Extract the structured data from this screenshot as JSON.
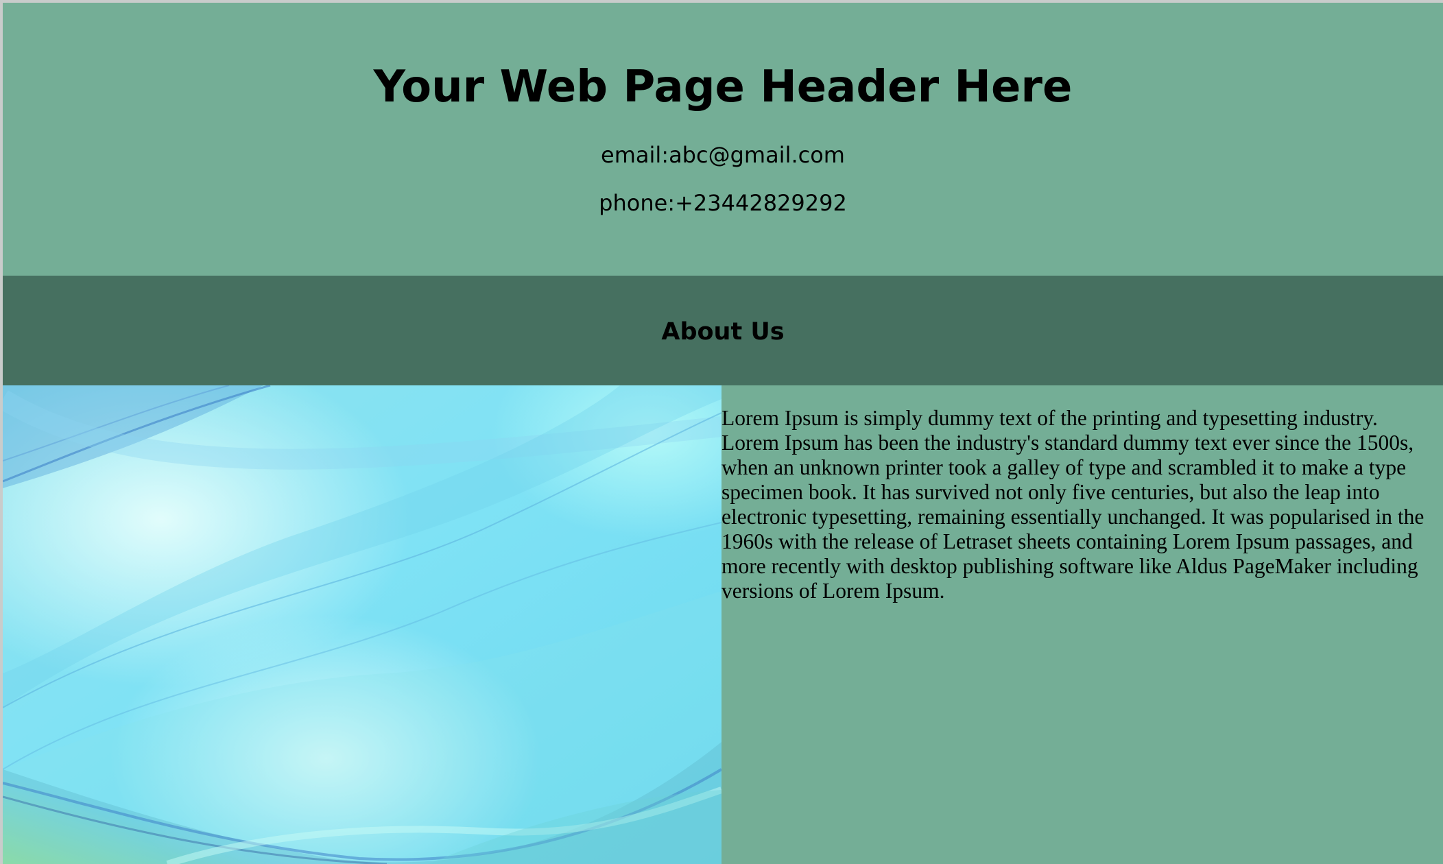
{
  "header": {
    "title": "Your Web Page Header Here",
    "email": "email:abc@gmail.com",
    "phone": "phone:+23442829292"
  },
  "about": {
    "heading": "About Us",
    "image_name": "abstract-wave-background-image",
    "paragraph": "Lorem Ipsum is simply dummy text of the printing and typesetting industry. Lorem Ipsum has been the industry's standard dummy text ever since the 1500s, when an unknown printer took a galley of type and scrambled it to make a type specimen book. It has survived not only five centuries, but also the leap into electronic typesetting, remaining essentially unchanged. It was popularised in the 1960s with the release of Letraset sheets containing Lorem Ipsum passages, and more recently with desktop publishing software like Aldus PageMaker including versions of Lorem Ipsum."
  },
  "colors": {
    "header_bg": "#74ae96",
    "about_band_bg": "#467060",
    "content_bg": "#74ae96",
    "image_primary": "#74e0f8",
    "image_highlight": "#d2fbf8",
    "image_accent_green": "#a8f08e",
    "image_wave_blue": "#3f82c8"
  }
}
